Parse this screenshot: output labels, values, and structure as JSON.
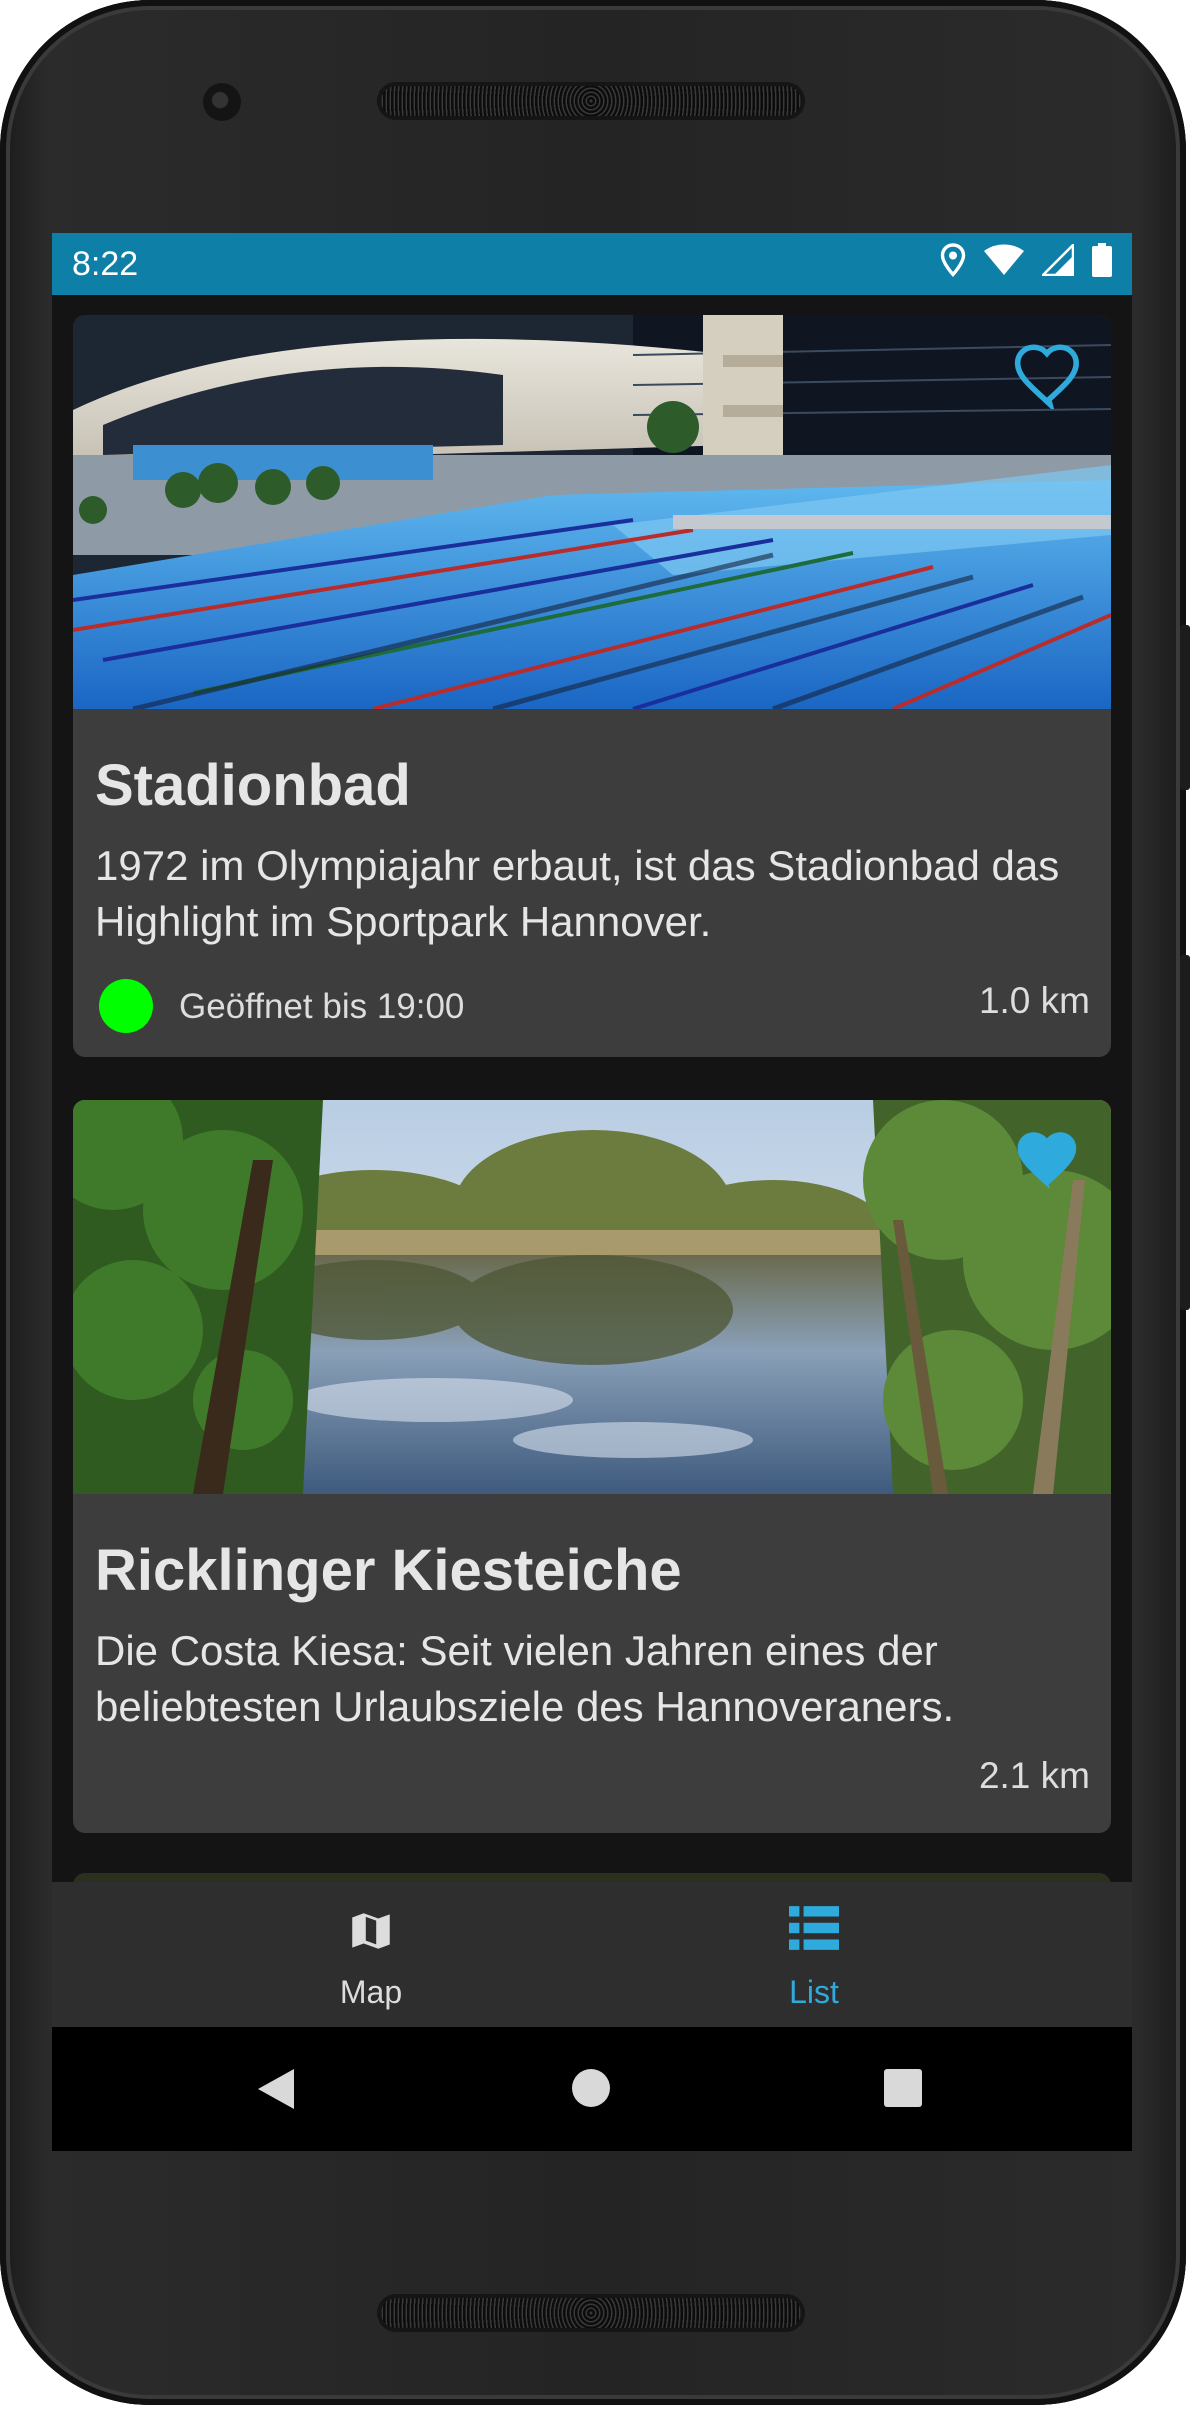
{
  "status_bar": {
    "time": "8:22",
    "icons": [
      "location-icon",
      "wifi-icon",
      "signal-icon",
      "battery-icon"
    ]
  },
  "places": [
    {
      "title": "Stadionbad",
      "description": "1972 im Olympiajahr erbaut, ist das Stadionbad das Highlight im Sportpark Hannover.",
      "opening_text": "Geöffnet bis 19:00",
      "opening_status_color": "#00ff00",
      "distance": "1.0 km",
      "favorite": false,
      "image": "indoor swimming pool"
    },
    {
      "title": "Ricklinger Kiesteiche",
      "description": "Die Costa Kiesa: Seit vielen Jahren eines der beliebtesten Urlaubsziele des Hannoveraners.",
      "distance": "2.1 km",
      "favorite": true,
      "image": "lake with trees"
    }
  ],
  "bottom_nav": {
    "items": [
      {
        "label": "Map",
        "icon": "map-icon",
        "active": false
      },
      {
        "label": "List",
        "icon": "list-icon",
        "active": true
      }
    ]
  },
  "colors": {
    "accent": "#2eaadc",
    "status_bar": "#0e7fa6",
    "card": "#3d3d3d",
    "background": "#141414"
  }
}
